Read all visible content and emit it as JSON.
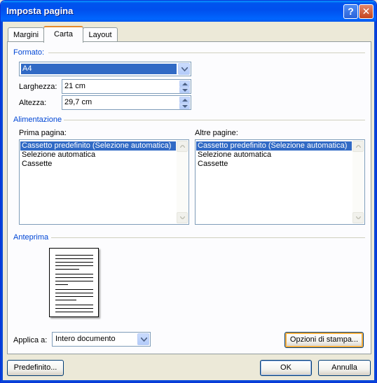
{
  "window": {
    "title": "Imposta pagina"
  },
  "titlebar_buttons": {
    "help": "?",
    "close": "✕"
  },
  "tabs": [
    {
      "label": "Margini",
      "active": false
    },
    {
      "label": "Carta",
      "active": true
    },
    {
      "label": "Layout",
      "active": false
    }
  ],
  "format": {
    "heading": "Formato:",
    "paper_size": "A4",
    "width_label": "Larghezza:",
    "width_value": "21 cm",
    "height_label": "Altezza:",
    "height_value": "29,7 cm"
  },
  "feed": {
    "heading": "Alimentazione",
    "first_page_label": "Prima pagina:",
    "other_pages_label": "Altre pagine:",
    "first_page_items": [
      "Cassetto predefinito (Selezione automatica)",
      "Selezione automatica",
      "Cassette"
    ],
    "other_pages_items": [
      "Cassetto predefinito (Selezione automatica)",
      "Selezione automatica",
      "Cassette"
    ],
    "selected_index": 0
  },
  "preview": {
    "heading": "Anteprima"
  },
  "apply": {
    "label": "Applica a:",
    "value": "Intero documento"
  },
  "buttons": {
    "print_options": "Opzioni di stampa...",
    "default": "Predefinito...",
    "ok": "OK",
    "cancel": "Annulla"
  },
  "colors": {
    "titlebar": "#0053ee",
    "section_heading": "#0046d5",
    "selection": "#316ac5",
    "active_tab_accent": "#e68b2c"
  }
}
